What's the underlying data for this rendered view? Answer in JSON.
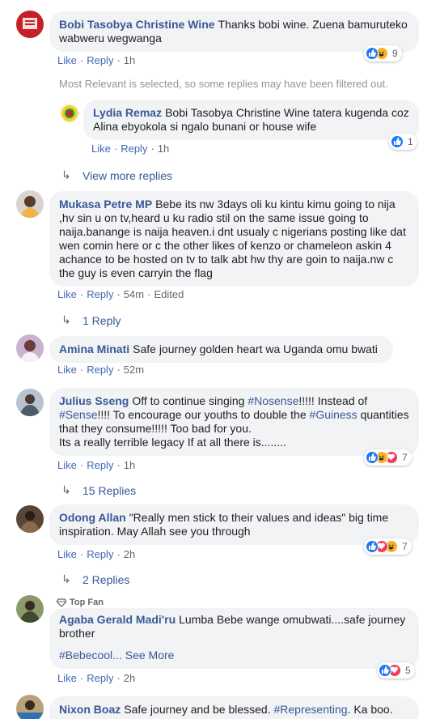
{
  "comments": [
    {
      "author": "Bobi Tasobya Christine Wine",
      "text": "Thanks bobi wine. Zuena bamuruteko wabweru wegwanga",
      "actions": {
        "like": "Like",
        "reply": "Reply",
        "time": "1h"
      },
      "reactions": {
        "icons": [
          "like-icon",
          "haha-icon"
        ],
        "count": "9"
      }
    },
    {
      "author": "Mukasa Petre MP",
      "text": "Bebe its nw 3days oli ku kintu kimu going to nija ,hv sin u on tv,heard u ku radio stil on the same issue going to naija.banange is naija heaven.i dnt usualy c nigerians posting like dat wen comin here or c the other likes of kenzo or chameleon askin 4 achance to be hosted on tv to talk abt hw thy are goin to naija.nw c the guy is even carryin the flag",
      "actions": {
        "like": "Like",
        "reply": "Reply",
        "time": "54m",
        "edited": "Edited"
      },
      "replies_link": "1 Reply"
    },
    {
      "author": "Amina Minati",
      "text": "Safe journey golden heart wa Uganda omu bwati",
      "actions": {
        "like": "Like",
        "reply": "Reply",
        "time": "52m"
      }
    },
    {
      "author": "Julius Sseng",
      "text_parts": {
        "p1": "Off to continue singing ",
        "tag1": "#Nosense",
        "p2": "!!!!! Instead of ",
        "tag2": "#Sense",
        "p3": "!!!! To encourage our youths to double the ",
        "tag3": "#Guiness",
        "p4": " quantities that they consume!!!!! Too bad for you.",
        "line2": "Its a really terrible legacy If at all there is........"
      },
      "actions": {
        "like": "Like",
        "reply": "Reply",
        "time": "1h"
      },
      "reactions": {
        "icons": [
          "like-icon",
          "haha-icon",
          "love-icon"
        ],
        "count": "7"
      },
      "replies_link": "15 Replies"
    },
    {
      "author": "Odong Allan",
      "text": "\"Really men stick to their values and ideas\" big time inspiration. May Allah see you through",
      "actions": {
        "like": "Like",
        "reply": "Reply",
        "time": "2h"
      },
      "reactions": {
        "icons": [
          "like-icon",
          "love-icon",
          "haha-icon"
        ],
        "count": "7"
      },
      "replies_link": "2 Replies"
    },
    {
      "badge": "Top Fan",
      "author": "Agaba Gerald Madi'ru",
      "text": "Lumba Bebe wange omubwati....safe journey brother",
      "hashtag": "#Bebecool...",
      "see_more": "See More",
      "actions": {
        "like": "Like",
        "reply": "Reply",
        "time": "2h"
      },
      "reactions": {
        "icons": [
          "like-icon",
          "love-icon"
        ],
        "count": "5"
      }
    },
    {
      "author": "Nixon Boaz",
      "text_start": "Safe journey and be blessed. ",
      "tag": "#Representing",
      "text_end": ". Ka boo."
    }
  ],
  "filter_notice": "Most Relevant is selected, so some replies may have been filtered out.",
  "reply": {
    "author": "Lydia Remaz",
    "text": "Bobi Tasobya Christine Wine tatera kugenda coz Alina ebyokola si ngalo bunani or house wife",
    "actions": {
      "like": "Like",
      "reply": "Reply",
      "time": "1h"
    },
    "reactions": {
      "icons": [
        "like-icon"
      ],
      "count": "1"
    }
  },
  "view_more_replies": "View more replies",
  "colors": {
    "link": "#385898",
    "bubble": "#f2f3f5",
    "like": "#2078f4",
    "haha": "#f7b125",
    "love": "#f33e58"
  }
}
